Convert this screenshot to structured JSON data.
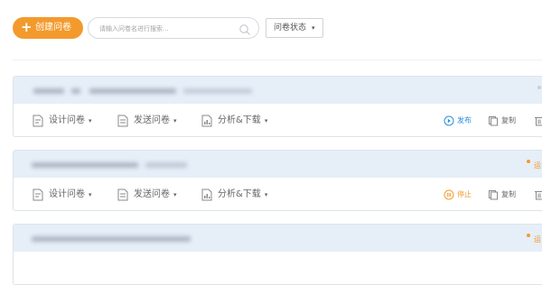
{
  "toolbar": {
    "create_button": "创建问卷",
    "search_placeholder": "请输入问卷名进行搜索...",
    "status_filter": "问卷状态",
    "caret": "▾",
    "plus": "+"
  },
  "actions": {
    "design": "设计问卷",
    "send": "发送问卷",
    "analyze": "分析&下载",
    "copy": "复制"
  },
  "surveys": [
    {
      "primary_label": "发布",
      "primary_color": "#2b8fd8",
      "status_text": "",
      "status_color": "#c7d0da"
    },
    {
      "primary_label": "停止",
      "primary_color": "#f39a2d",
      "status_text": "运",
      "status_color": "#f39a2d"
    },
    {
      "primary_label": "",
      "primary_color": "#f39a2d",
      "status_text": "运",
      "status_color": "#f39a2d"
    }
  ],
  "colors": {
    "accent": "#f39a2d",
    "header_bg": "#e6eef8",
    "link_blue": "#2b8fd8"
  }
}
